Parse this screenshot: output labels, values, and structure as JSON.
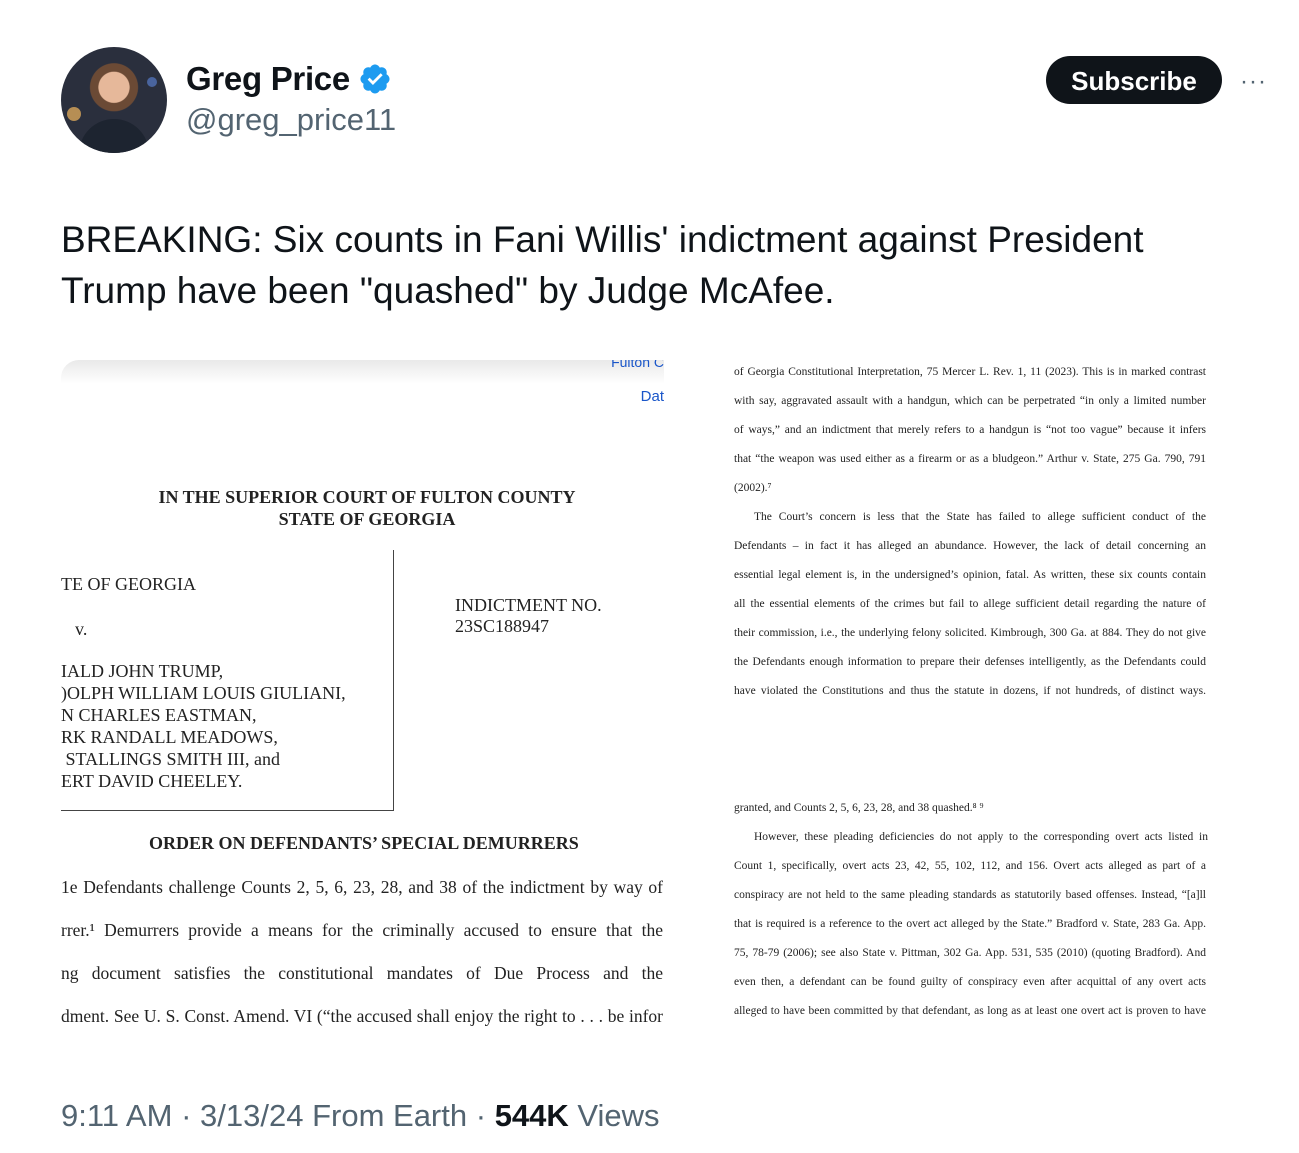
{
  "author": {
    "name": "Greg Price",
    "handle": "@greg_price11",
    "verified": true
  },
  "actions": {
    "subscribe_label": "Subscribe",
    "more_label": "···"
  },
  "tweet": {
    "text": "BREAKING: Six counts in Fani Willis' indictment against President Trump have been \"quashed\" by Judge McAfee."
  },
  "document_left": {
    "browser_top": "Fulton C",
    "browser_date": "Dat",
    "court_line1": "IN THE SUPERIOR COURT OF FULTON COUNTY",
    "court_line2": "STATE OF GEORGIA",
    "party_state": "TE OF GEORGIA",
    "versus": "v.",
    "defendants": [
      "IALD JOHN TRUMP,",
      ")OLPH WILLIAM LOUIS GIULIANI,",
      "N CHARLES EASTMAN,",
      "RK RANDALL MEADOWS,",
      " STALLINGS SMITH III, and",
      "ERT DAVID CHEELEY."
    ],
    "indictment_label": "INDICTMENT NO.",
    "indictment_number": "23SC188947",
    "order_title": "ORDER ON DEFENDANTS’ SPECIAL DEMURRERS",
    "body_lines": [
      "1e Defendants challenge Counts 2, 5, 6, 23, 28, and 38 of the indictment by way of",
      "rrer.¹ Demurrers provide a means for the criminally accused to ensure that the",
      "ng document satisfies the constitutional mandates of Due Process and the",
      "dment. See U. S. Const. Amend. VI (“the accused shall enjoy the right to . . . be infor"
    ]
  },
  "document_right": {
    "top_lines": [
      "of Georgia Constitutional Interpretation, 75 Mercer L. Rev. 1, 11 (2023). This is in marked contrast",
      "with say, aggravated assault with a handgun, which can be perpetrated “in only a limited number",
      "of ways,” and an indictment that merely refers to a handgun is “not too vague” because it infers",
      "that “the weapon was used either as a firearm or as a bludgeon.” Arthur v. State, 275 Ga. 790, 791",
      "(2002).⁷",
      "The Court’s concern is less that the State has failed to allege sufficient conduct of the",
      "Defendants – in fact it has alleged an abundance. However, the lack of detail concerning an",
      "essential legal element is, in the undersigned’s opinion, fatal. As written, these six counts contain",
      "all the essential elements of the crimes but fail to allege sufficient detail regarding the nature of",
      "their commission, i.e., the underlying felony solicited. Kimbrough, 300 Ga. at 884. They do not give",
      "the Defendants enough information to prepare their defenses intelligently, as the Defendants could",
      "have violated the Constitutions and thus the statute in dozens, if not hundreds, of distinct ways."
    ],
    "bottom_lines": [
      "granted, and Counts 2, 5, 6, 23, 28, and 38 quashed.⁸ ⁹",
      "However, these pleading deficiencies do not apply to the corresponding overt acts listed in",
      "Count 1, specifically, overt acts 23, 42, 55, 102, 112, and 156. Overt acts alleged as part of a",
      "conspiracy are not held to the same pleading standards as statutorily based offenses. Instead, “[a]ll",
      "that is required is a reference to the overt act alleged by the State.” Bradford v. State, 283 Ga. App.",
      "75, 78-79 (2006); see also State v. Pittman, 302 Ga. App. 531, 535 (2010) (quoting Bradford). And",
      "even then, a defendant can be found guilty of conspiracy even after acquittal of any overt acts",
      "alleged to have been committed by that defendant, as long as at least one overt act is proven to have"
    ]
  },
  "meta": {
    "time": "9:11 AM",
    "separator": "·",
    "date": "3/13/24",
    "source": "From Earth",
    "views_count": "544K",
    "views_label": "Views"
  },
  "colors": {
    "text_primary": "#0f1419",
    "text_secondary": "#536471",
    "verified_blue": "#1d9bf0",
    "button_bg": "#0f1419"
  }
}
